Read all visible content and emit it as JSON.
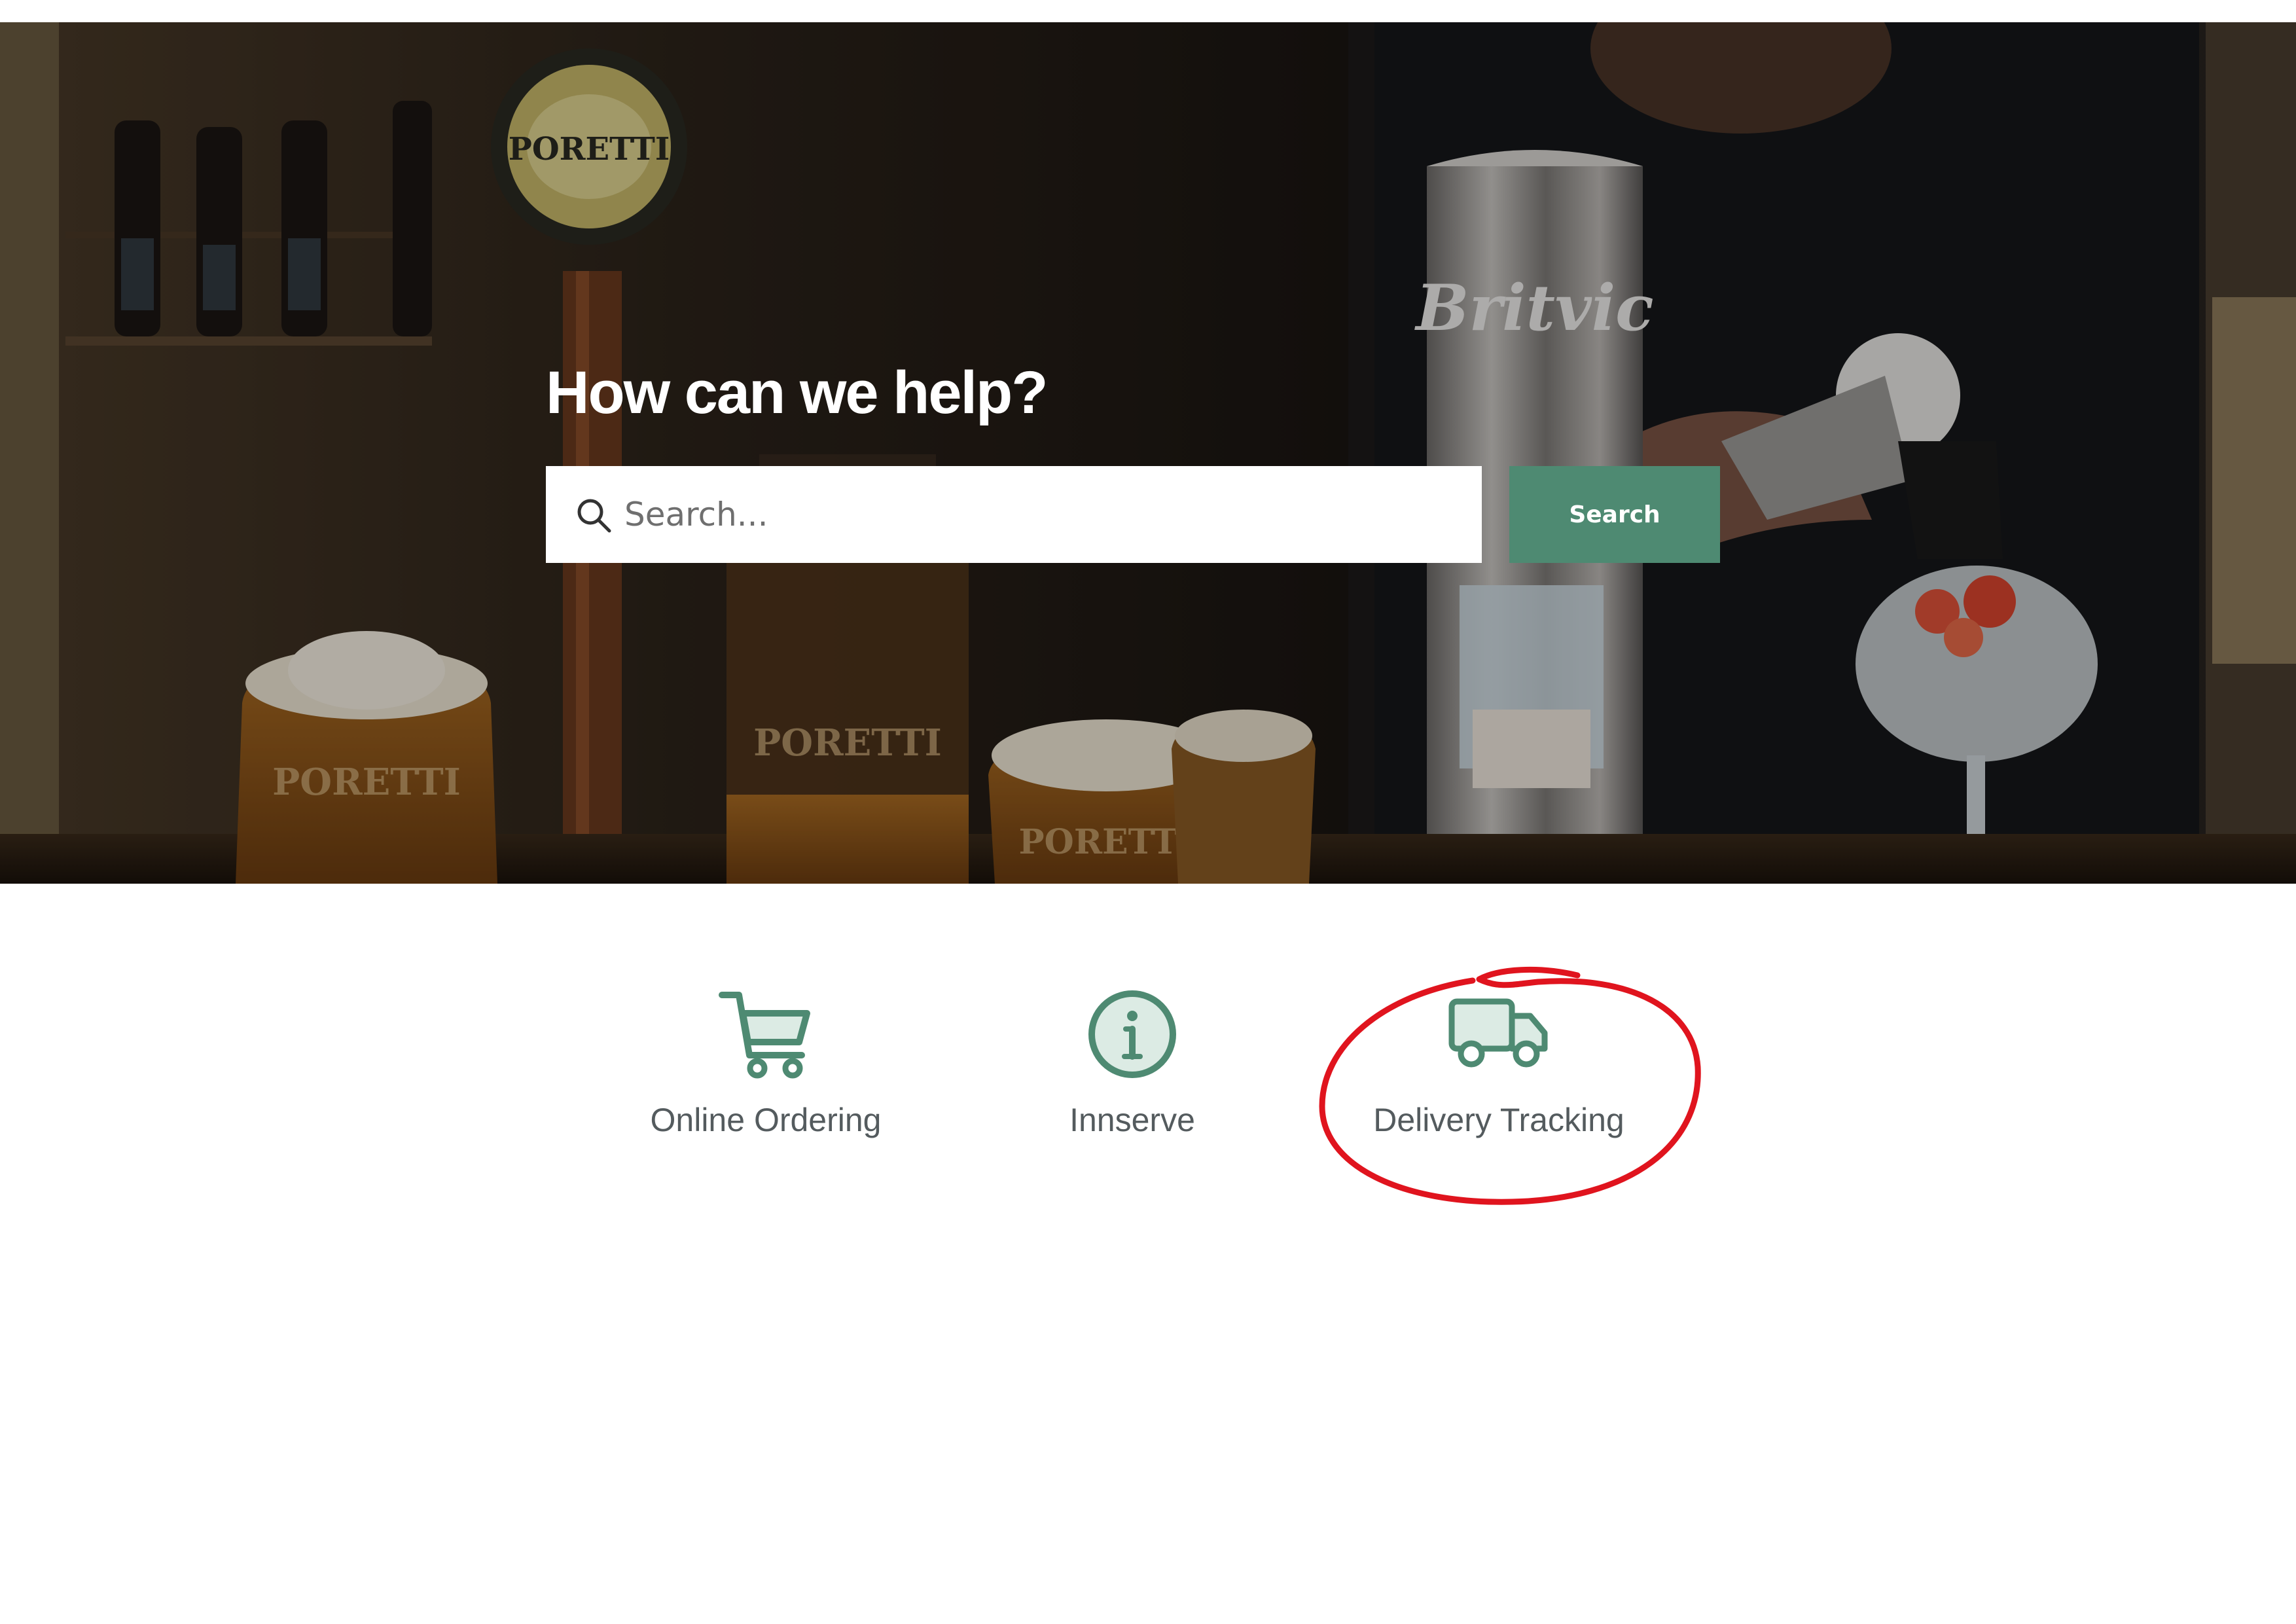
{
  "hero": {
    "title": "How can we help?",
    "background": "bar-taps-photo"
  },
  "search": {
    "placeholder": "Search...",
    "icon": "search-icon",
    "button_label": "Search"
  },
  "categories": [
    {
      "label": "Online Ordering",
      "icon": "shopping-cart-icon"
    },
    {
      "label": "Innserve",
      "icon": "info-circle-icon"
    },
    {
      "label": "Delivery Tracking",
      "icon": "delivery-truck-icon",
      "highlighted": true
    }
  ],
  "colors": {
    "accent": "#4e8a72",
    "label_text": "#545b5e",
    "annotation": "#e0141e"
  }
}
